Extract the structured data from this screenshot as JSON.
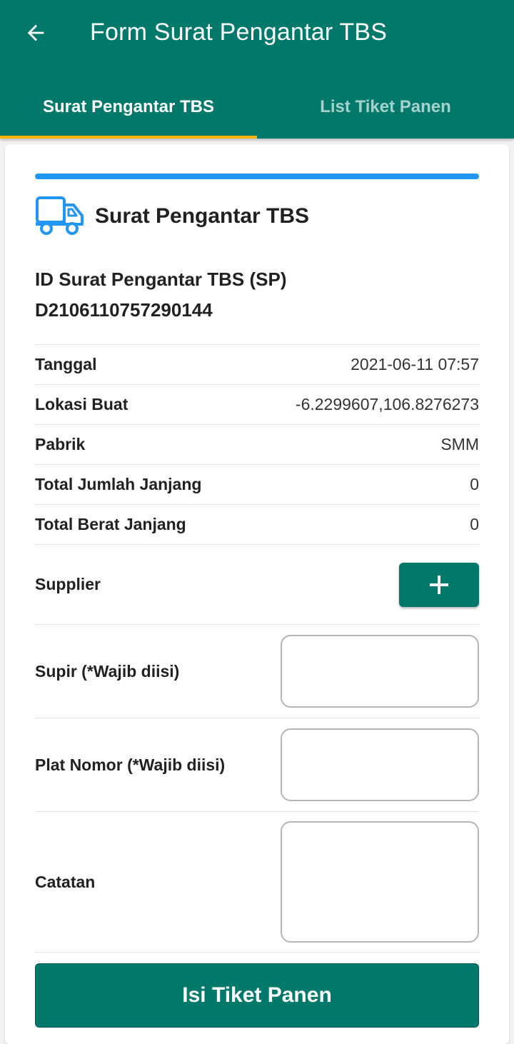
{
  "appbar": {
    "title": "Form Surat Pengantar TBS",
    "back_icon": "arrow-left-icon",
    "color": "#00796b"
  },
  "tabs": [
    {
      "label": "Surat Pengantar TBS",
      "active": true
    },
    {
      "label": "List Tiket Panen",
      "active": false
    }
  ],
  "colors": {
    "primary": "#00796b",
    "tab_indicator": "#ffb300",
    "progress": "#2196f3",
    "truck_icon": "#2196f3"
  },
  "card": {
    "header_icon": "truck-icon",
    "header_title": "Surat Pengantar TBS",
    "id_label": "ID Surat Pengantar TBS (SP)",
    "id_value": "D2106110757290144"
  },
  "details": [
    {
      "label": "Tanggal",
      "value": "2021-06-11 07:57"
    },
    {
      "label": "Lokasi Buat",
      "value": "-6.2299607,106.8276273"
    },
    {
      "label": "Pabrik",
      "value": "SMM"
    },
    {
      "label": "Total Jumlah Janjang",
      "value": "0"
    },
    {
      "label": "Total Berat Janjang",
      "value": "0"
    }
  ],
  "supplier": {
    "label": "Supplier",
    "add_icon": "plus-icon"
  },
  "fields": {
    "supir": {
      "label": "Supir (*Wajib diisi)",
      "value": ""
    },
    "plat": {
      "label": "Plat Nomor (*Wajib diisi)",
      "value": ""
    },
    "catatan": {
      "label": "Catatan",
      "value": ""
    }
  },
  "submit_label": "Isi Tiket Panen"
}
